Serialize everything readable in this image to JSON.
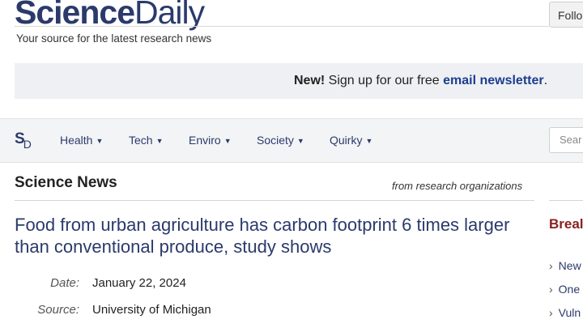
{
  "header": {
    "logo_part1": "Science",
    "logo_part2": "Daily",
    "tagline": "Your source for the latest research news",
    "follow_label": "Follo"
  },
  "promo": {
    "new_label": "New!",
    "text": " Sign up for our free ",
    "link": "email newsletter",
    "end": "."
  },
  "nav": {
    "logo_s": "S",
    "logo_d": "D",
    "items": [
      "Health",
      "Tech",
      "Enviro",
      "Society",
      "Quirky"
    ],
    "search_placeholder": "Sear"
  },
  "section": {
    "title": "Science News",
    "subtitle": "from research organizations"
  },
  "article": {
    "headline": "Food from urban agriculture has carbon footprint 6 times larger than conventional produce, study shows",
    "date_label": "Date:",
    "date_value": "January 22, 2024",
    "source_label": "Source:",
    "source_value": "University of Michigan"
  },
  "sidebar": {
    "title": "Breal",
    "items": [
      "New",
      "One",
      "Vuln"
    ]
  },
  "colors": {
    "brand": "#2b3a6b",
    "link": "#1d3d8f",
    "sidebar_title": "#8a2020",
    "promo_bg": "#eef0f3",
    "nav_bg": "#f3f4f6"
  }
}
